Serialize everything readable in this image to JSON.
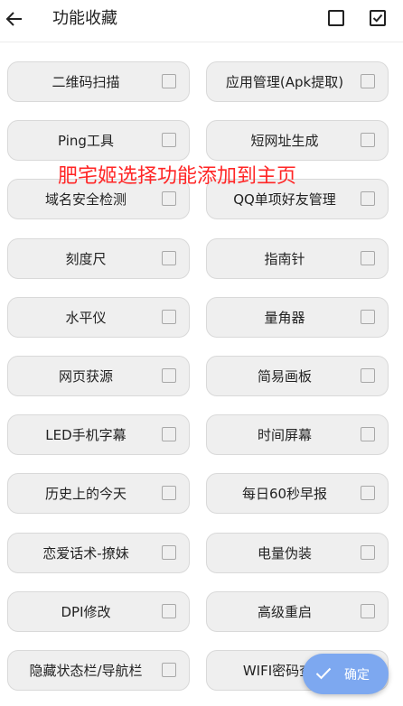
{
  "header": {
    "title": "功能收藏"
  },
  "overlay_text": "肥宅姬选择功能添加到主页",
  "items": [
    {
      "label": "二维码扫描"
    },
    {
      "label": "应用管理(Apk提取)"
    },
    {
      "label": "Ping工具"
    },
    {
      "label": "短网址生成"
    },
    {
      "label": "域名安全检测"
    },
    {
      "label": "QQ单项好友管理"
    },
    {
      "label": "刻度尺"
    },
    {
      "label": "指南针"
    },
    {
      "label": "水平仪"
    },
    {
      "label": "量角器"
    },
    {
      "label": "网页获源"
    },
    {
      "label": "简易画板"
    },
    {
      "label": "LED手机字幕"
    },
    {
      "label": "时间屏幕"
    },
    {
      "label": "历史上的今天"
    },
    {
      "label": "每日60秒早报"
    },
    {
      "label": "恋爱话术-撩妹"
    },
    {
      "label": "电量伪装"
    },
    {
      "label": "DPI修改"
    },
    {
      "label": "高级重启"
    },
    {
      "label": "隐藏状态栏/导航栏"
    },
    {
      "label": "WIFI密码查看"
    }
  ],
  "fab": {
    "label": "确定"
  },
  "colors": {
    "accent": "#7da8f0",
    "overlay_text": "#ff2626",
    "item_bg": "#efefef"
  }
}
